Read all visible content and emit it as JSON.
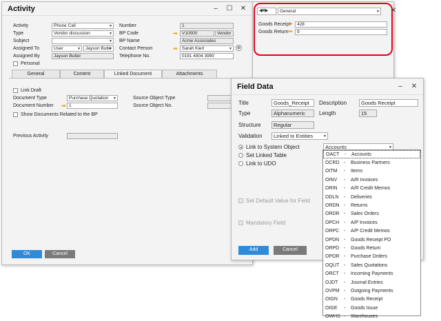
{
  "activity": {
    "title": "Activity",
    "left_labels": [
      "Activity",
      "Type",
      "Subject",
      "Assigned To",
      "Assigned By"
    ],
    "activity_value": "Phone Call",
    "type_value": "Vendor discussion",
    "subject_value": "",
    "assigned_to_value": "User",
    "assigned_to_name": "Jayson Butle",
    "assigned_by_value": "Jayson Butler",
    "personal_label": "Personal",
    "right_labels": [
      "Number",
      "BP Code",
      "BP Name",
      "Contact Person",
      "Telephone No."
    ],
    "number_value": "1",
    "bp_code_value": "V10000",
    "bp_code_extra": "Vendor",
    "bp_name_value": "Acme Associates",
    "contact_person_value": "Sarah Kierl",
    "telephone_value": "0191 4904 3990",
    "tabs": [
      "General",
      "Content",
      "Linked Document",
      "Attachments"
    ],
    "link_draft_label": "Link Draft",
    "document_type_label": "Document Type",
    "document_type_value": "Purchase Quotation",
    "document_number_label": "Document Number",
    "document_number_value": "1",
    "source_object_type_label": "Source Object Type",
    "source_object_no_label": "Source Object No.",
    "show_docs_label": "Show Documents Related to the BP",
    "previous_activity_label": "Previous Activity",
    "ok_label": "OK",
    "cancel_label": "Cancel"
  },
  "side_panel": {
    "nav_value": "General",
    "goods_receipt_label": "Goods Receipt",
    "goods_receipt_value": "428",
    "goods_return_label": "Goods Return",
    "goods_return_value": "9",
    "highlight_color": "#e0001a"
  },
  "field_data": {
    "title": "Field Data",
    "title_label": "Title",
    "title_value": "Goods_Receipt",
    "description_label": "Description",
    "description_value": "Goods Receipt",
    "type_label": "Type",
    "type_value": "Alphanumeric",
    "length_label": "Length",
    "length_value": "15",
    "structure_label": "Structure",
    "structure_value": "Regular",
    "validation_label": "Validation",
    "validation_value": "Linked to Entities",
    "radio_link_system": "Link to System Object",
    "radio_linked_table": "Set Linked Table",
    "radio_link_udo": "Link to UDO",
    "object_select_value": "Accounts",
    "set_default_label": "Set Default Value for Field",
    "mandatory_label": "Mandatory Field",
    "add_label": "Add",
    "cancel_label": "Cancel",
    "objects": [
      {
        "code": "OACT",
        "name": "Accounts"
      },
      {
        "code": "OCRD",
        "name": "Business Partners"
      },
      {
        "code": "OITM",
        "name": "Items"
      },
      {
        "code": "OINV",
        "name": "A/R Invoices"
      },
      {
        "code": "ORIN",
        "name": "A/R Credit Memos"
      },
      {
        "code": "ODLN",
        "name": "Deliveries"
      },
      {
        "code": "ORDN",
        "name": "Returns"
      },
      {
        "code": "ORDR",
        "name": "Sales Orders"
      },
      {
        "code": "OPCH",
        "name": "A/P Invoices"
      },
      {
        "code": "ORPC",
        "name": "A/P Credit Memos"
      },
      {
        "code": "OPDN",
        "name": "Goods Receipt PO"
      },
      {
        "code": "ORPD",
        "name": "Goods Return"
      },
      {
        "code": "OPOR",
        "name": "Purchase Orders"
      },
      {
        "code": "OQUT",
        "name": "Sales Quotations"
      },
      {
        "code": "ORCT",
        "name": "Incoming Payments"
      },
      {
        "code": "OJDT",
        "name": "Journal Entries"
      },
      {
        "code": "OVPM",
        "name": "Outgoing Payments"
      },
      {
        "code": "OIGN",
        "name": "Goods Receipt"
      },
      {
        "code": "OIGE",
        "name": "Goods Issue"
      },
      {
        "code": "OWHS",
        "name": "Warehouses"
      }
    ],
    "separator": "-"
  },
  "window_controls": {
    "minimize": "–",
    "maximize": "☐",
    "close": "✕"
  }
}
